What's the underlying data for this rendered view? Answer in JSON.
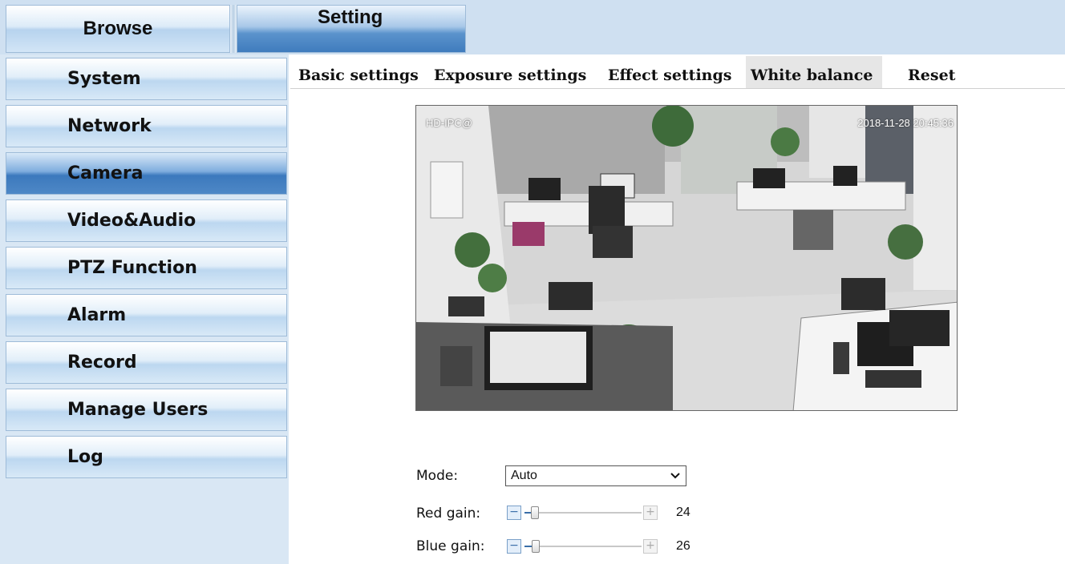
{
  "top_tabs": {
    "browse": "Browse",
    "setting": "Setting"
  },
  "sidebar": {
    "items": [
      {
        "label": "System"
      },
      {
        "label": "Network"
      },
      {
        "label": "Camera",
        "active": true
      },
      {
        "label": "Video&Audio"
      },
      {
        "label": "PTZ Function"
      },
      {
        "label": "Alarm"
      },
      {
        "label": "Record"
      },
      {
        "label": "Manage Users"
      },
      {
        "label": "Log"
      }
    ]
  },
  "sub_tabs": {
    "basic": "Basic settings",
    "exposure": "Exposure settings",
    "effect": "Effect settings",
    "white_balance": "White balance",
    "reset": "Reset",
    "active": "white_balance"
  },
  "video": {
    "osd_name": "HD-IPC@",
    "osd_timestamp": "2018-11-28  20:45:36"
  },
  "white_balance": {
    "mode_label": "Mode:",
    "mode_value": "Auto",
    "red_gain_label": "Red gain:",
    "red_gain_value": "24",
    "red_gain_fraction": 0.24,
    "blue_gain_label": "Blue gain:",
    "blue_gain_value": "26",
    "blue_gain_fraction": 0.26,
    "minus_symbol": "−",
    "plus_symbol": "+"
  },
  "colors": {
    "topbar_bg": "#cfe0f1",
    "active_blue": "#3f7cbd",
    "sidebar_bg": "#d9e7f4"
  }
}
